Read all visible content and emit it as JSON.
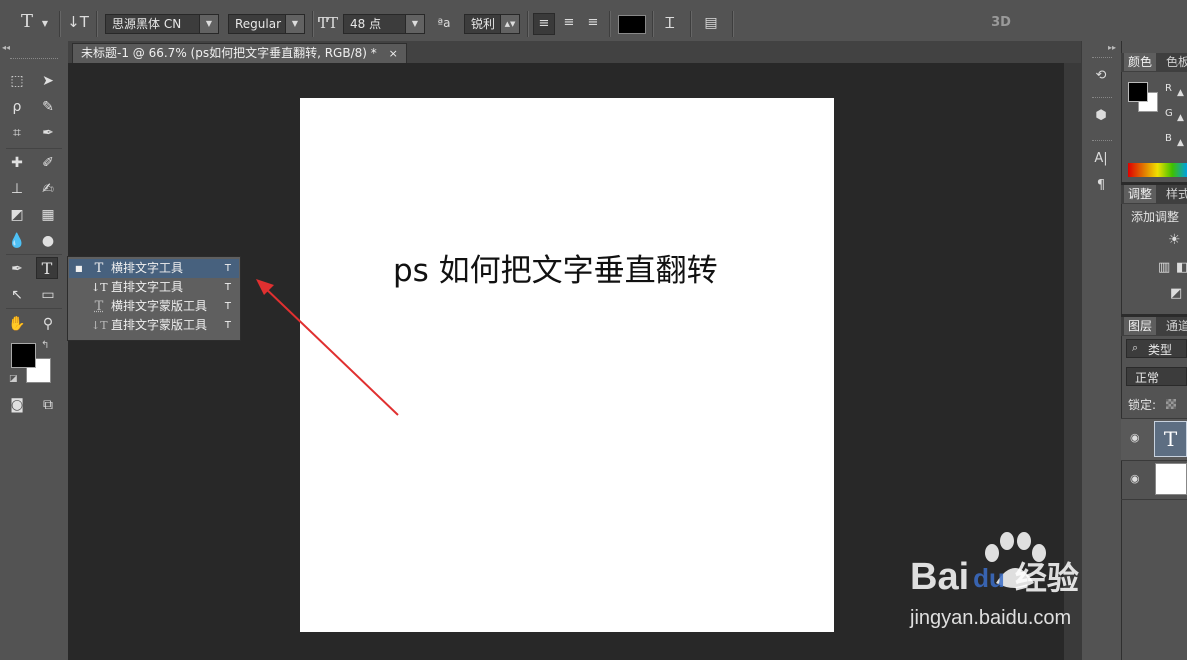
{
  "options_bar": {
    "tool_icon": "type-tool-icon",
    "orientation_icon": "toggle-text-orientation-icon",
    "font_family": "思源黑体 CN",
    "font_style": "Regular",
    "font_size": "48 点",
    "anti_alias": "锐利",
    "mode_3d_label": "3D"
  },
  "document_tab": {
    "title": "未标题-1 @ 66.7% (ps如何把文字垂直翻转, RGB/8) *",
    "close": "×"
  },
  "canvas": {
    "text": "ps 如何把文字垂直翻转"
  },
  "tool_flyout": {
    "items": [
      {
        "label": "横排文字工具",
        "shortcut": "T",
        "icon": "horizontal-type-icon",
        "glyph": "T",
        "selected": true
      },
      {
        "label": "直排文字工具",
        "shortcut": "T",
        "icon": "vertical-type-icon",
        "glyph": "↓T",
        "selected": false
      },
      {
        "label": "横排文字蒙版工具",
        "shortcut": "T",
        "icon": "horizontal-type-mask-icon",
        "glyph": "T",
        "selected": false
      },
      {
        "label": "直排文字蒙版工具",
        "shortcut": "T",
        "icon": "vertical-type-mask-icon",
        "glyph": "↓T",
        "selected": false
      }
    ]
  },
  "panels": {
    "color_tab": "颜色",
    "swatches_tab": "色板",
    "channel_labels": [
      "R",
      "G",
      "B"
    ],
    "adjust_tab": "调整",
    "styles_tab": "样式",
    "add_adjustment": "添加调整",
    "layers_tab": "图层",
    "channels_tab": "通道",
    "filter_kind": "类型",
    "blend_mode": "正常",
    "lock_label": "锁定:",
    "text_layer_glyph": "T"
  },
  "watermark": {
    "brand_bai": "Bai",
    "brand_du": "du",
    "brand_cn": "经验",
    "url": "jingyan.baidu.com"
  },
  "colors": {
    "selection_blue": "#47617e",
    "arrow_red": "#e03030",
    "canvas_bg": "#ffffff",
    "workspace": "#282828"
  }
}
